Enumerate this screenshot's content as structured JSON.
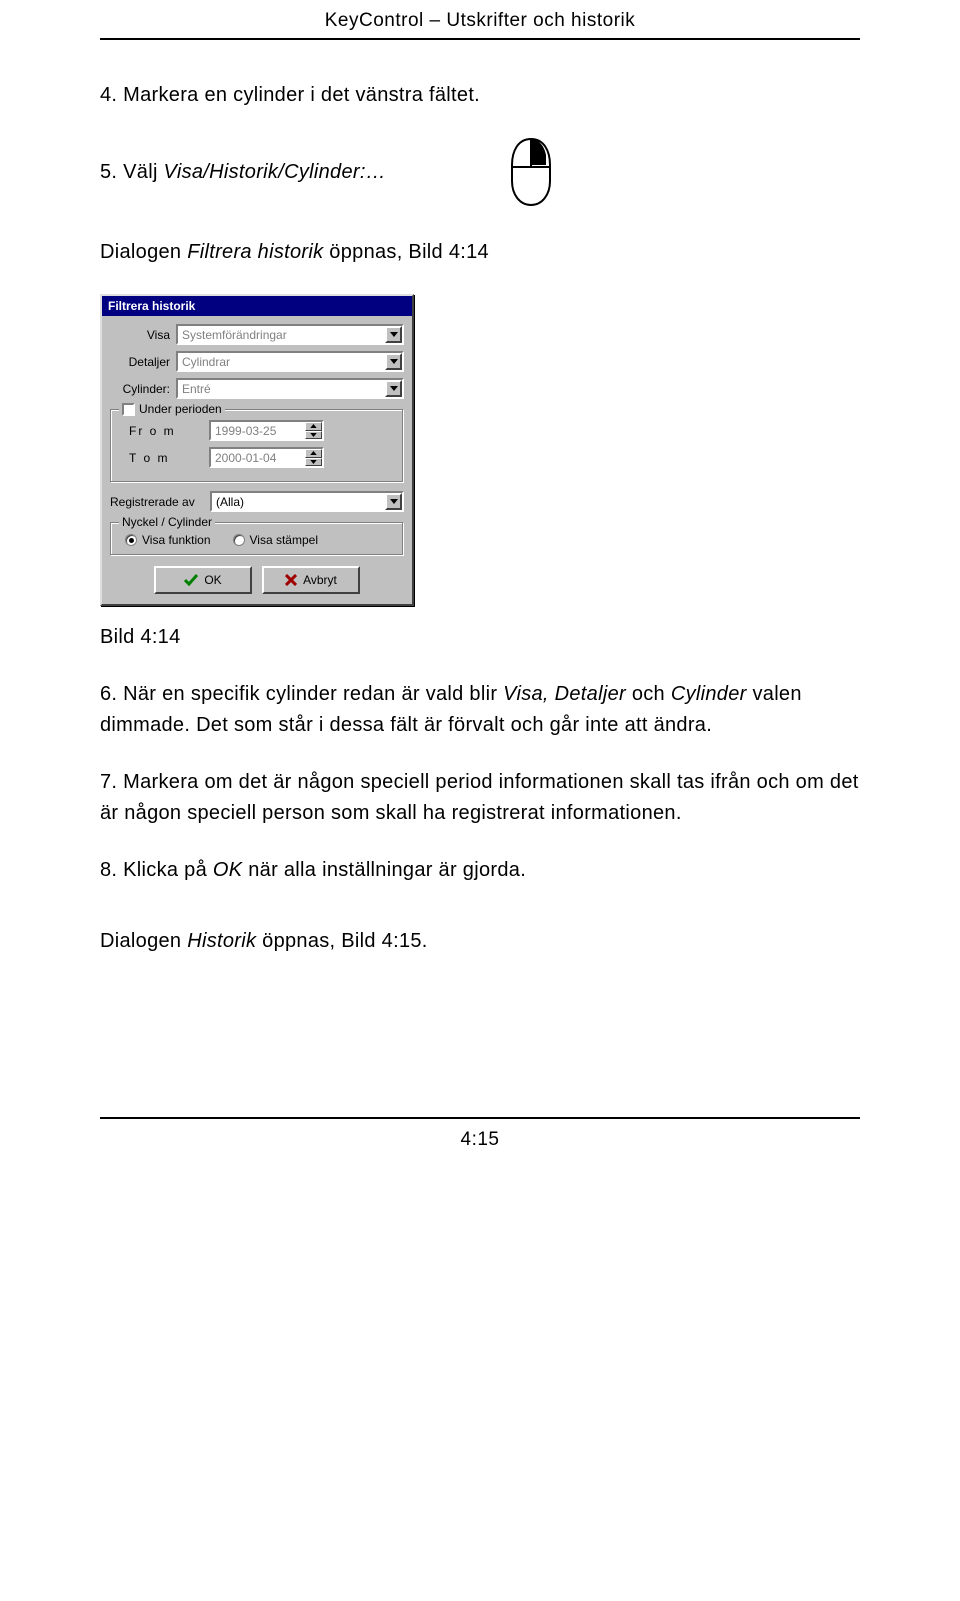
{
  "header": {
    "title": "KeyControl  –  Utskrifter och historik"
  },
  "text": {
    "step4": "4. Markera en cylinder i det vänstra fältet.",
    "step5_prefix": "5. Välj ",
    "step5_italic": "Visa/Historik/Cylinder:…",
    "step5b_prefix": "Dialogen ",
    "step5b_italic": "Filtrera historik",
    "step5b_suffix": " öppnas, Bild 4:14",
    "caption": "Bild 4:14",
    "step6_prefix": "6. När en specifik cylinder redan är vald blir ",
    "step6_i1": "Visa,",
    "step6_mid1": " ",
    "step6_i2": "Detaljer",
    "step6_mid2": " och ",
    "step6_i3": "Cylinder",
    "step6_suffix": " valen dimmade. Det som står i dessa fält är förvalt och går inte att ändra.",
    "step7": "7. Markera om det är någon speciell period informationen skall tas ifrån och om det är någon speciell person som skall ha registrerat informationen.",
    "step8_prefix": "8. Klicka på ",
    "step8_italic": "OK",
    "step8_suffix": " när alla inställningar är gjorda.",
    "closing_prefix": "Dialogen ",
    "closing_italic": "Historik",
    "closing_suffix": " öppnas, Bild 4:15."
  },
  "dialog": {
    "title": "Filtrera historik",
    "visa_label": "Visa",
    "visa_value": "Systemförändringar",
    "detaljer_label": "Detaljer",
    "detaljer_value": "Cylindrar",
    "cylinder_label": "Cylinder:",
    "cylinder_value": "Entré",
    "period_title": "Under perioden",
    "from_label": "Fr o m",
    "from_value": "1999-03-25",
    "to_label": "T o m",
    "to_value": "2000-01-04",
    "reg_label": "Registrerade av",
    "reg_value": "(Alla)",
    "nyckel_title": "Nyckel / Cylinder",
    "radio1": "Visa funktion",
    "radio2": "Visa stämpel",
    "ok": "OK",
    "cancel": "Avbryt"
  },
  "footer": {
    "page": "4:15"
  }
}
